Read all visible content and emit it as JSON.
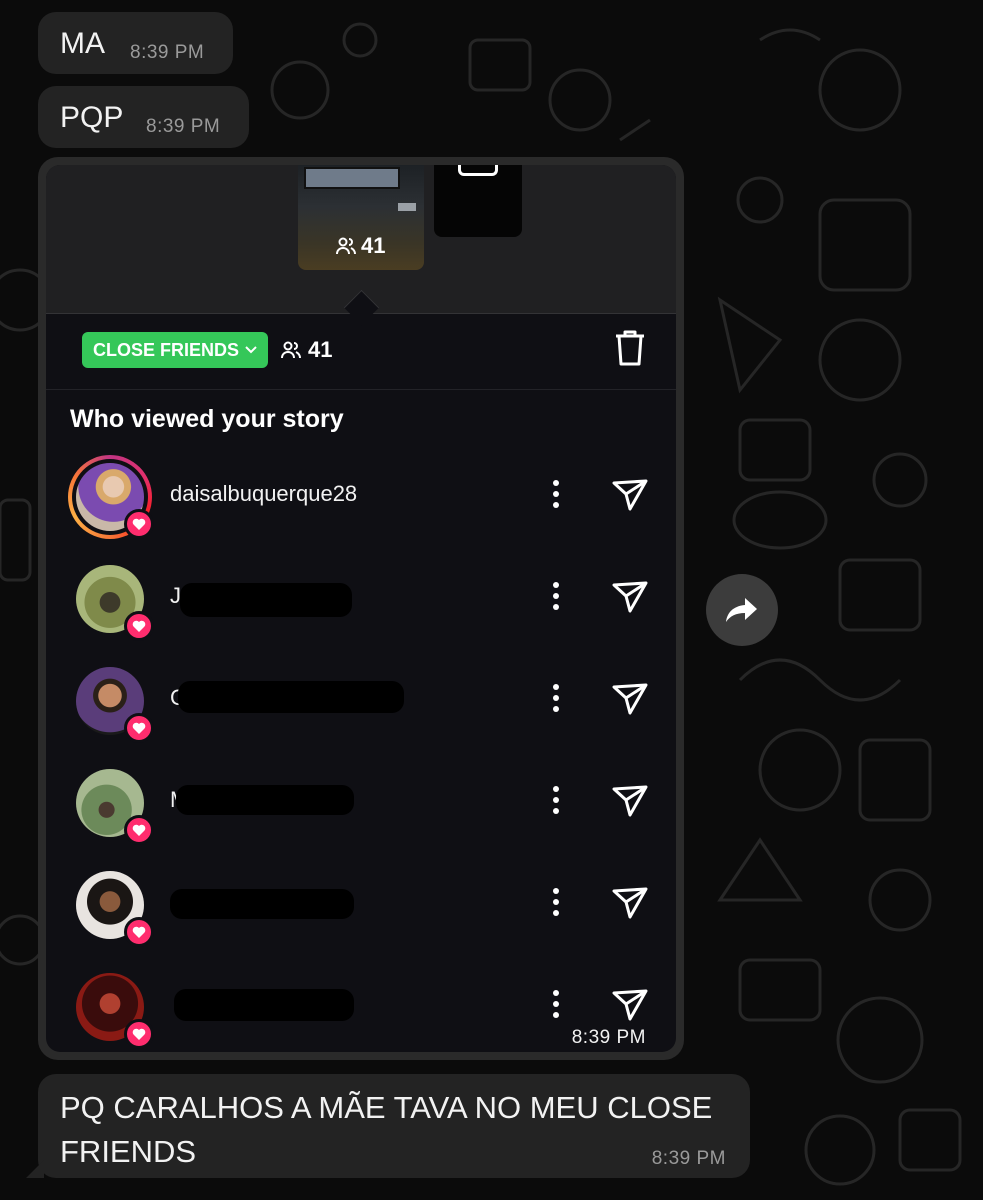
{
  "messages": [
    {
      "text": "MA",
      "time": "8:39 PM"
    },
    {
      "text": "PQP",
      "time": "8:39 PM"
    },
    {
      "image_time": "8:39 PM"
    },
    {
      "text_line1": "PQ CARALHOS A MÃE TAVA NO MEU CLOSE",
      "text_line2": "FRIENDS",
      "time": "8:39 PM"
    }
  ],
  "story": {
    "thumb_viewer_count": "41",
    "audience_badge": "CLOSE FRIENDS",
    "viewer_count": "41",
    "heading": "Who viewed your story",
    "viewers": [
      {
        "username": "daisalbuquerque28",
        "has_story_ring": true
      },
      {
        "username": "J",
        "redacted": true
      },
      {
        "username": "C",
        "redacted": true
      },
      {
        "username": "M",
        "redacted": true
      },
      {
        "username": "",
        "redacted": true
      },
      {
        "username": "",
        "redacted": true
      }
    ]
  },
  "icons": {
    "people": "people-icon",
    "trash": "trash-icon",
    "more": "more-vertical-icon",
    "send": "send-icon",
    "heart": "heart-icon",
    "forward": "forward-icon",
    "chevron": "chevron-down-icon"
  },
  "colors": {
    "close_friends_green": "#35c759",
    "heart_pink": "#ff2d6e",
    "bubble": "#232323"
  }
}
